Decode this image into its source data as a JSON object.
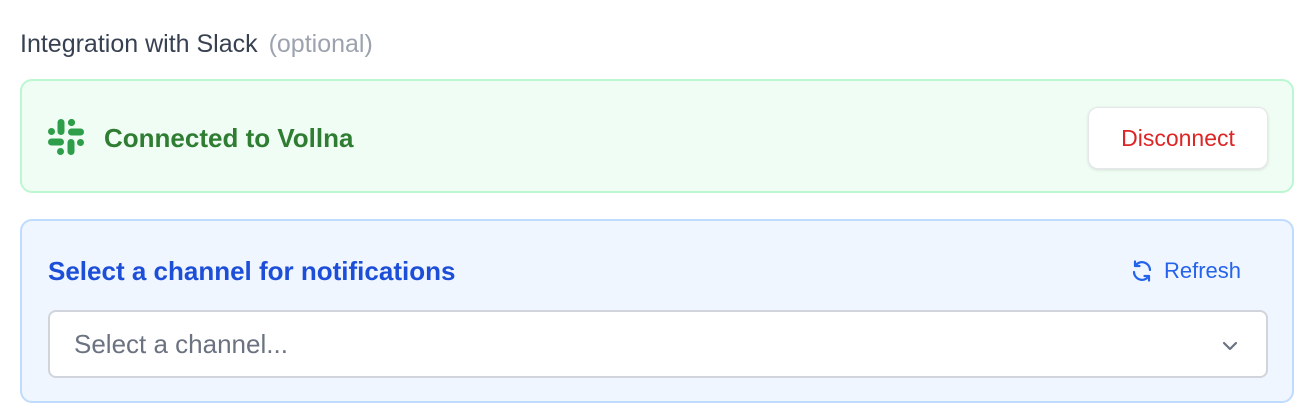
{
  "section": {
    "title": "Integration with Slack",
    "optional_label": "(optional)"
  },
  "connection": {
    "status_text": "Connected to Vollna",
    "disconnect_label": "Disconnect",
    "icon": "slack-icon",
    "colors": {
      "background": "#f0fdf4",
      "border": "#bbf7d0",
      "text": "#2e7d32",
      "icon": "#2e9e4a",
      "danger": "#dc2626"
    }
  },
  "channel": {
    "title": "Select a channel for notifications",
    "refresh_label": "Refresh",
    "refresh_icon": "refresh-icon",
    "select": {
      "placeholder": "Select a channel...",
      "value": ""
    },
    "colors": {
      "background": "#eff6ff",
      "border": "#bfdbfe",
      "accent": "#1d4ed8"
    }
  }
}
